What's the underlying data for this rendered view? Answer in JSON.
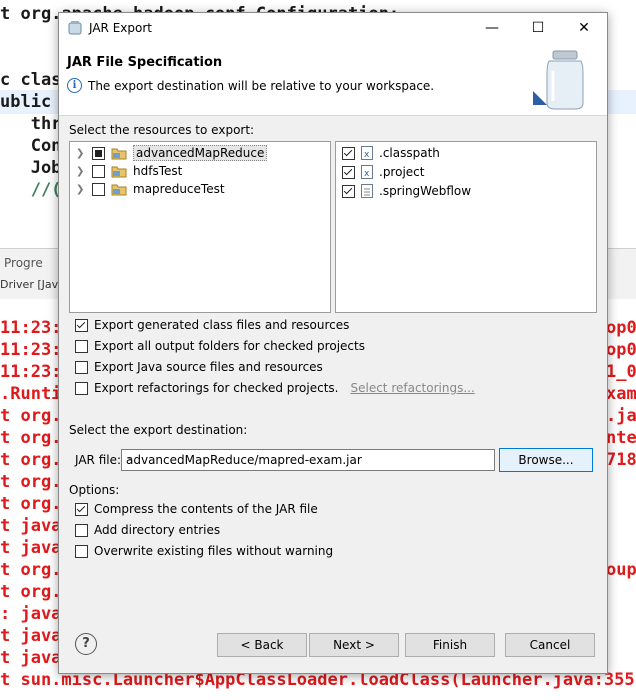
{
  "background": {
    "code_lines": [
      "t org.apache.hadoop.conf.Configuration;",
      "",
      "c clas",
      "ublic",
      "   thr",
      "   Con",
      "   Job",
      "   //("
    ],
    "progress_tab": "Progre",
    "driver_label": "Driver [Java",
    "console_lines": [
      "11:23:",
      "11:23:",
      "11:23:",
      ".Runti",
      "t org.",
      "t org.",
      "t org.",
      "t org.",
      "t org.",
      "t java",
      "t java",
      "t org.",
      "t org.",
      ": java",
      "t java",
      "t java",
      "t sun.misc.Launcher$AppClassLoader.loadClass(Launcher.java:355)"
    ],
    "console_right": [
      "op0",
      "op0",
      "1_0",
      "xam",
      ".ja",
      "nte",
      "718",
      "",
      "",
      "",
      "",
      "oup"
    ]
  },
  "dialog": {
    "title": "JAR Export",
    "header_title": "JAR File Specification",
    "header_info": "The export destination will be relative to your workspace.",
    "resources_label": "Select the resources to export:",
    "projects": [
      {
        "name": "advancedMapReduce",
        "state": "partial",
        "selected": true
      },
      {
        "name": "hdfsTest",
        "state": "unchecked",
        "selected": false
      },
      {
        "name": "mapreduceTest",
        "state": "unchecked",
        "selected": false
      }
    ],
    "files": [
      {
        "name": ".classpath",
        "checked": true,
        "icon": "x-file"
      },
      {
        "name": ".project",
        "checked": true,
        "icon": "x-file"
      },
      {
        "name": ".springWebflow",
        "checked": true,
        "icon": "text-file"
      }
    ],
    "export_options": [
      {
        "label": "Export generated class files and resources",
        "checked": true
      },
      {
        "label": "Export all output folders for checked projects",
        "checked": false
      },
      {
        "label": "Export Java source files and resources",
        "checked": false
      },
      {
        "label": "Export refactorings for checked projects.",
        "checked": false
      }
    ],
    "select_refactorings_link": "Select refactorings...",
    "destination_label": "Select the export destination:",
    "jar_file_label": "JAR file:",
    "jar_file_value": "advancedMapReduce/mapred-exam.jar",
    "browse_label": "Browse...",
    "options_label": "Options:",
    "options": [
      {
        "label": "Compress the contents of the JAR file",
        "checked": true
      },
      {
        "label": "Add directory entries",
        "checked": false
      },
      {
        "label": "Overwrite existing files without warning",
        "checked": false
      }
    ],
    "buttons": {
      "back": "< Back",
      "next": "Next >",
      "finish": "Finish",
      "cancel": "Cancel"
    },
    "help": "?"
  }
}
